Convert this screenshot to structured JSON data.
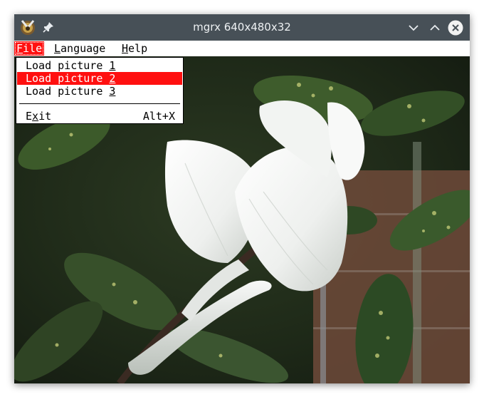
{
  "window": {
    "title": "mgrx 640x480x32"
  },
  "menubar": {
    "file": {
      "pre": "",
      "accel": "F",
      "post": "ile"
    },
    "language": {
      "pre": "",
      "accel": "L",
      "post": "anguage"
    },
    "help": {
      "pre": "",
      "accel": "H",
      "post": "elp"
    }
  },
  "file_menu": {
    "items": [
      {
        "pre": "Load picture ",
        "accel": "1",
        "post": "",
        "selected": false
      },
      {
        "pre": "Load picture ",
        "accel": "2",
        "post": "",
        "selected": true
      },
      {
        "pre": "Load picture ",
        "accel": "3",
        "post": "",
        "selected": false
      }
    ],
    "exit": {
      "pre": "E",
      "accel": "x",
      "post": "it",
      "shortcut": "Alt+X"
    }
  },
  "colors": {
    "titlebar": "#475057",
    "highlight": "#ff1010",
    "menu_bg": "#ffffff"
  },
  "icons": [
    "app-icon",
    "pin-icon",
    "minimize-icon",
    "maximize-icon",
    "close-icon"
  ]
}
